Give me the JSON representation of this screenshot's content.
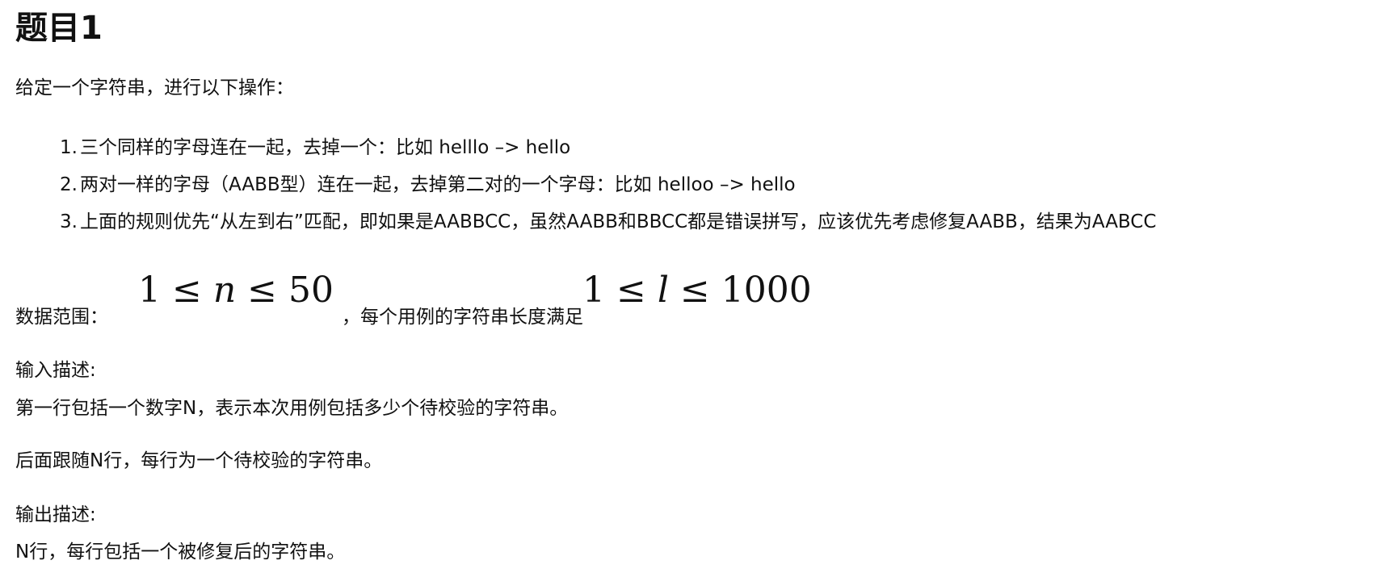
{
  "title": "题目1",
  "intro": "给定一个字符串，进行以下操作：",
  "rules": [
    {
      "num": "1.",
      "text": "三个同样的字母连在一起，去掉一个：比如 helllo –> hello"
    },
    {
      "num": "2.",
      "text": "两对一样的字母（AABB型）连在一起，去掉第二对的一个字母：比如 helloo –> hello"
    },
    {
      "num": "3.",
      "text": "上面的规则优先“从左到右”匹配，即如果是AABBCC，虽然AABB和BBCC都是错误拼写，应该优先考虑修复AABB，结果为AABCC"
    }
  ],
  "range": {
    "label": "数据范围：",
    "math1": {
      "lo": "1 ≤ ",
      "var": "n",
      "hi": " ≤ 50"
    },
    "mid": "，每个用例的字符串长度满足",
    "math2": {
      "lo": "1 ≤ ",
      "var": "l",
      "hi": " ≤ 1000"
    }
  },
  "input": {
    "heading": "输入描述:",
    "line1": "第一行包括一个数字N，表示本次用例包括多少个待校验的字符串。",
    "line2": "后面跟随N行，每行为一个待校验的字符串。"
  },
  "output": {
    "heading": "输出描述:",
    "line1": "N行，每行包括一个被修复后的字符串。"
  }
}
